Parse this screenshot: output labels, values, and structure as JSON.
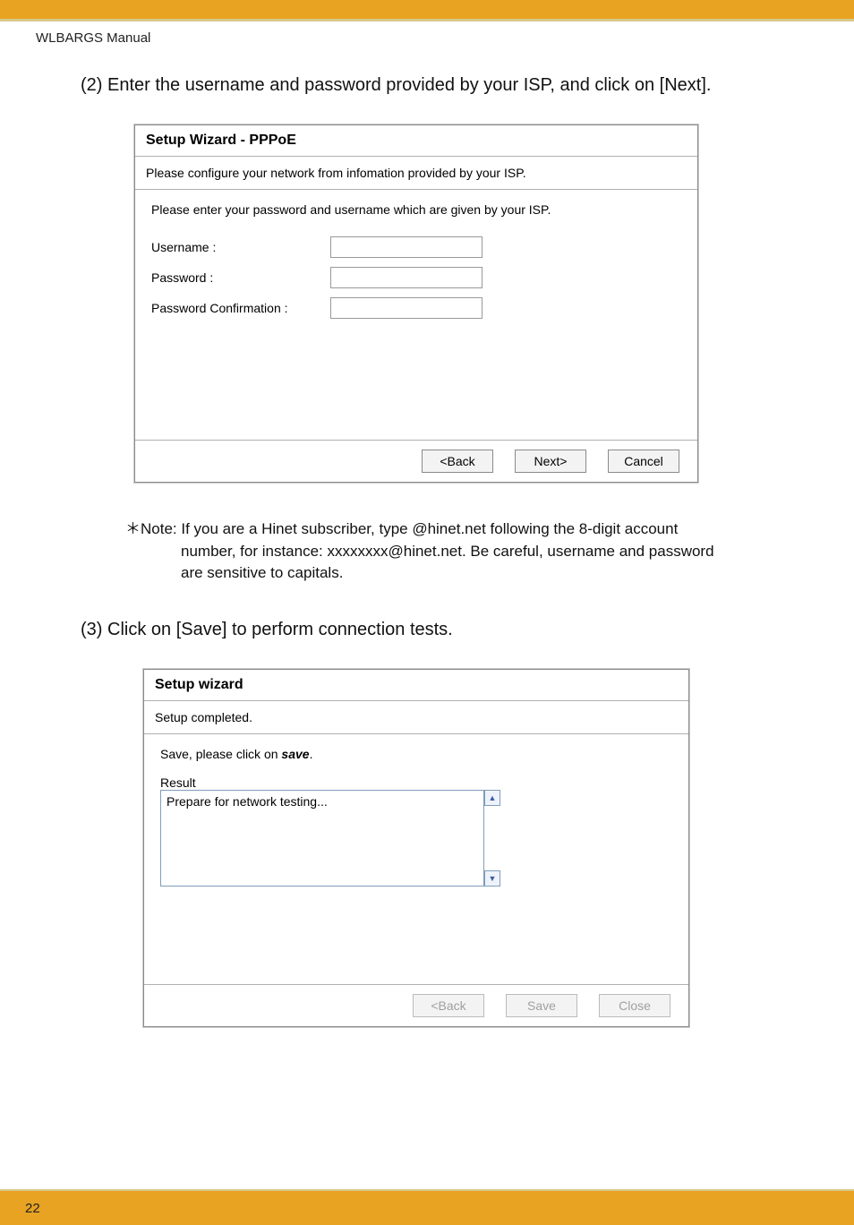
{
  "header": {
    "manual_title": "WLBARGS Manual"
  },
  "page_number": "22",
  "step2": {
    "heading": "(2) Enter the username and password provided by your ISP, and click on [Next].",
    "wizard": {
      "title": "Setup Wizard - PPPoE",
      "subtitle": "Please configure your network from infomation provided by your ISP.",
      "body_intro": "Please enter your password and username which are given by your ISP.",
      "labels": {
        "username": "Username :",
        "password": "Password :",
        "password_confirm": "Password Confirmation :"
      },
      "buttons": {
        "back": "<Back",
        "next": "Next>",
        "cancel": "Cancel"
      }
    },
    "note_prefix": "＊Note: ",
    "note_line1": "If you are a Hinet subscriber, type @hinet.net following the 8-digit account",
    "note_line2": "number, for instance: xxxxxxxx@hinet.net. Be careful, username and password",
    "note_line3": "are sensitive to capitals."
  },
  "step3": {
    "heading": "(3) Click on [Save] to perform connection tests.",
    "wizard": {
      "title": "Setup wizard",
      "subtitle": "Setup completed.",
      "save_text_pre": "Save, please click on ",
      "save_word": "save",
      "save_text_post": ".",
      "result_label": "Result",
      "result_content": "Prepare for network testing...",
      "buttons": {
        "back": "<Back",
        "save": "Save",
        "close": "Close"
      }
    }
  }
}
